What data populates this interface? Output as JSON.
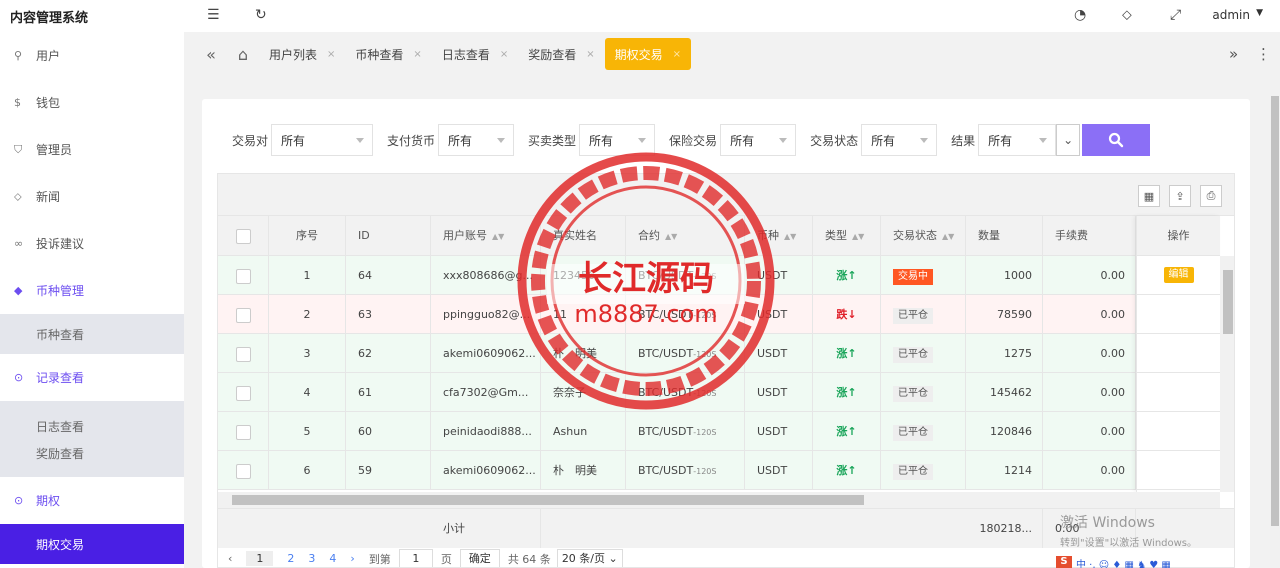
{
  "app": {
    "title": "内容管理系统",
    "user": "admin"
  },
  "topbar": {
    "icons": [
      "menu-fold-icon",
      "refresh-icon",
      "theme-icon",
      "tag-icon",
      "fullscreen-icon"
    ]
  },
  "sidebar": {
    "items": [
      {
        "label": "用户",
        "icon": "user-icon"
      },
      {
        "label": "钱包",
        "icon": "dollar-icon"
      },
      {
        "label": "管理员",
        "icon": "shield-icon"
      },
      {
        "label": "新闻",
        "icon": "tag-icon"
      },
      {
        "label": "投诉建议",
        "icon": "link-icon"
      },
      {
        "label": "币种管理",
        "icon": "diamond-icon",
        "sub": [
          "币种查看"
        ]
      },
      {
        "label": "记录查看",
        "icon": "record-icon",
        "sub": [
          "日志查看",
          "奖励查看"
        ]
      },
      {
        "label": "期权",
        "icon": "option-icon",
        "sub": [
          "期权交易"
        ]
      }
    ]
  },
  "tabs": {
    "items": [
      "用户列表",
      "币种查看",
      "日志查看",
      "奖励查看",
      "期权交易"
    ],
    "active": "期权交易",
    "close": "×"
  },
  "filters": {
    "items": [
      {
        "label": "交易对",
        "value": "所有"
      },
      {
        "label": "支付货币",
        "value": "所有"
      },
      {
        "label": "买卖类型",
        "value": "所有"
      },
      {
        "label": "保险交易",
        "value": "所有"
      },
      {
        "label": "交易状态",
        "value": "所有"
      },
      {
        "label": "结果",
        "value": "所有"
      }
    ]
  },
  "table": {
    "columns": [
      "序号",
      "ID",
      "用户账号",
      "真实姓名",
      "合约",
      "币种",
      "类型",
      "交易状态",
      "数量",
      "手续费"
    ],
    "action_header": "操作",
    "rows": [
      {
        "no": "1",
        "id": "64",
        "account": "xxx808686@g...",
        "name": "123456",
        "contract": "BTC/USDT",
        "period": "-120S",
        "coin": "USDT",
        "type": "涨↑",
        "dir": "up",
        "status": "交易中",
        "status_kind": "red",
        "qty": "1000",
        "fee": "0.00",
        "action": "编辑"
      },
      {
        "no": "2",
        "id": "63",
        "account": "ppingguo82@...",
        "name": "11",
        "contract": "BTC/USDT",
        "period": "-120S",
        "coin": "USDT",
        "type": "跌↓",
        "dir": "down",
        "status": "已平仓",
        "status_kind": "gray",
        "qty": "78590",
        "fee": "0.00",
        "action": ""
      },
      {
        "no": "3",
        "id": "62",
        "account": "akemi0609062...",
        "name": "朴　明美",
        "contract": "BTC/USDT",
        "period": "-120S",
        "coin": "USDT",
        "type": "涨↑",
        "dir": "up",
        "status": "已平仓",
        "status_kind": "gray",
        "qty": "1275",
        "fee": "0.00",
        "action": ""
      },
      {
        "no": "4",
        "id": "61",
        "account": "cfa7302@Gm...",
        "name": "奈奈子",
        "contract": "BTC/USDT",
        "period": "-120S",
        "coin": "USDT",
        "type": "涨↑",
        "dir": "up",
        "status": "已平仓",
        "status_kind": "gray",
        "qty": "145462",
        "fee": "0.00",
        "action": ""
      },
      {
        "no": "5",
        "id": "60",
        "account": "peinidaodi888...",
        "name": "Ashun",
        "contract": "BTC/USDT",
        "period": "-120S",
        "coin": "USDT",
        "type": "涨↑",
        "dir": "up",
        "status": "已平仓",
        "status_kind": "gray",
        "qty": "120846",
        "fee": "0.00",
        "action": ""
      },
      {
        "no": "6",
        "id": "59",
        "account": "akemi0609062...",
        "name": "朴　明美",
        "contract": "BTC/USDT",
        "period": "-120S",
        "coin": "USDT",
        "type": "涨↑",
        "dir": "up",
        "status": "已平仓",
        "status_kind": "gray",
        "qty": "1214",
        "fee": "0.00",
        "action": ""
      }
    ],
    "footer": {
      "label": "小计",
      "qty": "180218...",
      "fee": "0.00"
    }
  },
  "pagination": {
    "pages": [
      "1",
      "2",
      "3",
      "4"
    ],
    "goto_label": "到第",
    "goto_value": "1",
    "page_unit": "页",
    "confirm": "确定",
    "total": "共 64 条",
    "page_size": "20 条/页"
  },
  "watermark": {
    "line1": "长江源码",
    "line2": "m8887.com"
  },
  "windows_activation": {
    "line1": "激活 Windows",
    "line2": "转到\"设置\"以激活 Windows。"
  },
  "ime_bar": {
    "badge": "S",
    "text": "中 ·, ☺ ♦ ▦ ♞ ♥ ▦"
  },
  "colors": {
    "accent": "#6c4ef0",
    "tab_active": "#f8b506",
    "search_btn": "#8b6ff6",
    "up": "#1aa55a",
    "down": "#e0202a",
    "stamp": "#e02a2a"
  }
}
